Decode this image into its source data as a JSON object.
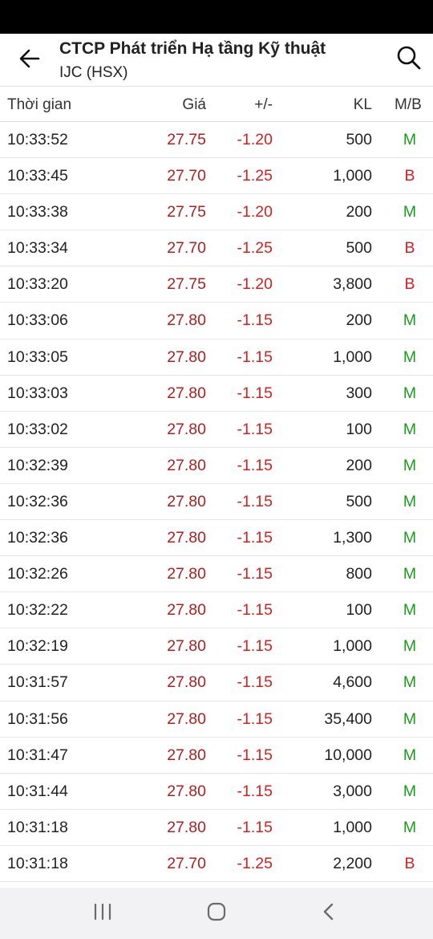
{
  "header": {
    "title": "CTCP Phát triển Hạ tầng Kỹ thuật",
    "subtitle": "IJC (HSX)",
    "back_icon": "arrow-left-icon",
    "search_icon": "search-icon"
  },
  "table": {
    "columns": {
      "time": "Thời gian",
      "price": "Giá",
      "change": "+/-",
      "volume": "KL",
      "side": "M/B"
    },
    "rows": [
      {
        "time": "10:33:52",
        "price": "27.75",
        "change": "-1.20",
        "volume": "500",
        "side": "M"
      },
      {
        "time": "10:33:45",
        "price": "27.70",
        "change": "-1.25",
        "volume": "1,000",
        "side": "B"
      },
      {
        "time": "10:33:38",
        "price": "27.75",
        "change": "-1.20",
        "volume": "200",
        "side": "M"
      },
      {
        "time": "10:33:34",
        "price": "27.70",
        "change": "-1.25",
        "volume": "500",
        "side": "B"
      },
      {
        "time": "10:33:20",
        "price": "27.75",
        "change": "-1.20",
        "volume": "3,800",
        "side": "B"
      },
      {
        "time": "10:33:06",
        "price": "27.80",
        "change": "-1.15",
        "volume": "200",
        "side": "M"
      },
      {
        "time": "10:33:05",
        "price": "27.80",
        "change": "-1.15",
        "volume": "1,000",
        "side": "M"
      },
      {
        "time": "10:33:03",
        "price": "27.80",
        "change": "-1.15",
        "volume": "300",
        "side": "M"
      },
      {
        "time": "10:33:02",
        "price": "27.80",
        "change": "-1.15",
        "volume": "100",
        "side": "M"
      },
      {
        "time": "10:32:39",
        "price": "27.80",
        "change": "-1.15",
        "volume": "200",
        "side": "M"
      },
      {
        "time": "10:32:36",
        "price": "27.80",
        "change": "-1.15",
        "volume": "500",
        "side": "M"
      },
      {
        "time": "10:32:36",
        "price": "27.80",
        "change": "-1.15",
        "volume": "1,300",
        "side": "M"
      },
      {
        "time": "10:32:26",
        "price": "27.80",
        "change": "-1.15",
        "volume": "800",
        "side": "M"
      },
      {
        "time": "10:32:22",
        "price": "27.80",
        "change": "-1.15",
        "volume": "100",
        "side": "M"
      },
      {
        "time": "10:32:19",
        "price": "27.80",
        "change": "-1.15",
        "volume": "1,000",
        "side": "M"
      },
      {
        "time": "10:31:57",
        "price": "27.80",
        "change": "-1.15",
        "volume": "4,600",
        "side": "M"
      },
      {
        "time": "10:31:56",
        "price": "27.80",
        "change": "-1.15",
        "volume": "35,400",
        "side": "M"
      },
      {
        "time": "10:31:47",
        "price": "27.80",
        "change": "-1.15",
        "volume": "10,000",
        "side": "M"
      },
      {
        "time": "10:31:44",
        "price": "27.80",
        "change": "-1.15",
        "volume": "3,000",
        "side": "M"
      },
      {
        "time": "10:31:18",
        "price": "27.80",
        "change": "-1.15",
        "volume": "1,000",
        "side": "M"
      },
      {
        "time": "10:31:18",
        "price": "27.70",
        "change": "-1.25",
        "volume": "2,200",
        "side": "B"
      }
    ]
  },
  "colors": {
    "price": "#b01e1e",
    "change": "#d42020",
    "buy": "#1a9a1a",
    "sell": "#d42020"
  },
  "nav": {
    "recents_icon": "recent-apps-icon",
    "home_icon": "home-icon",
    "back_icon": "back-chevron-icon"
  }
}
